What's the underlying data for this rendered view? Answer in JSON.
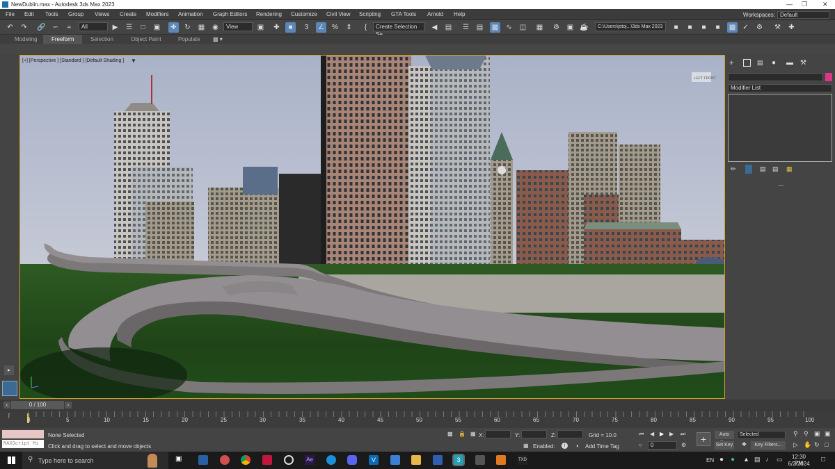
{
  "window": {
    "title": "NewDublin.max - Autodesk 3ds Max 2023"
  },
  "menu": [
    "File",
    "Edit",
    "Tools",
    "Group",
    "Views",
    "Create",
    "Modifiers",
    "Animation",
    "Graph Editors",
    "Rendering",
    "Customize",
    "Civil View",
    "Scripting",
    "GTA Tools",
    "Arnold",
    "Help"
  ],
  "workspace": {
    "label": "Workspaces:",
    "value": "Default"
  },
  "toolbar": {
    "filter": "All",
    "ref_coord": "View",
    "selection_set": "Create Selection Se",
    "path": "C:\\Users\\jstoj...\\3ds Max 2023"
  },
  "ribbon_tabs": [
    "Modeling",
    "Freeform",
    "Selection",
    "Object Paint",
    "Populate"
  ],
  "viewport": {
    "label": "[+] [Perspective ] [Standard ] [Default Shading ]"
  },
  "command_panel": {
    "modifier_list": "Modifier List",
    "color_swatch": "#e0338a"
  },
  "timeline": {
    "frame": "0 / 100",
    "ticks": [
      "0",
      "5",
      "10",
      "15",
      "20",
      "25",
      "30",
      "35",
      "40",
      "45",
      "50",
      "55",
      "60",
      "65",
      "70",
      "75",
      "80",
      "85",
      "90",
      "95",
      "100"
    ]
  },
  "status": {
    "selection": "None Selected",
    "prompt": "Click and drag to select and move objects",
    "maxscript": "MAXScript Mi",
    "x_label": "X:",
    "y_label": "Y:",
    "z_label": "Z:",
    "grid": "Grid = 10.0",
    "enabled": "Enabled:",
    "add_time_tag": "Add Time Tag",
    "auto_key": "Auto Key",
    "set_key": "Set Key",
    "selected": "Selected",
    "key_filters": "Key Filters...",
    "current_frame": "0"
  },
  "taskbar": {
    "search": "Type here to search",
    "lang": "EN",
    "time": "12:30 PM",
    "date": "6/2/2024"
  }
}
